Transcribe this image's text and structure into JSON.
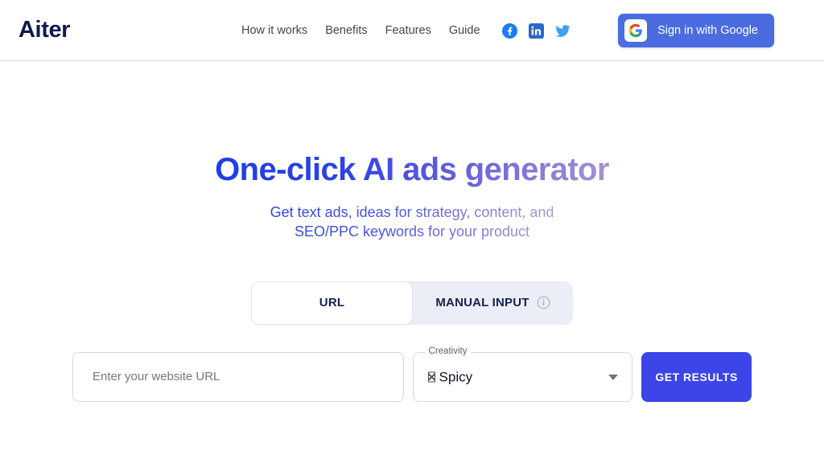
{
  "header": {
    "logo": "Aiter",
    "nav_items": [
      {
        "label": "How it works",
        "name": "nav-how-it-works"
      },
      {
        "label": "Benefits",
        "name": "nav-benefits"
      },
      {
        "label": "Features",
        "name": "nav-features"
      },
      {
        "label": "Guide",
        "name": "nav-guide"
      }
    ],
    "socials": [
      {
        "icon": "facebook-icon",
        "color": "#1d7bf2"
      },
      {
        "icon": "linkedin-icon",
        "color": "#2a68c8"
      },
      {
        "icon": "twitter-icon",
        "color": "#3ba1f0"
      }
    ],
    "google_button": {
      "label": "Sign in with Google",
      "icon": "google-g-icon",
      "background": "#4a6ce0"
    }
  },
  "hero": {
    "headline": "One-click AI ads generator",
    "headline_gradient_from": "#1f3ee8",
    "headline_gradient_to": "#a394d2",
    "subhead_line1": "Get text ads, ideas for strategy, content, and",
    "subhead_line2": "SEO/PPC keywords for your product"
  },
  "tabs": {
    "items": [
      {
        "label": "URL",
        "active": true,
        "name": "tab-url"
      },
      {
        "label": "MANUAL INPUT",
        "active": false,
        "name": "tab-manual-input",
        "info_icon": "info-circle-icon"
      }
    ],
    "track_background": "#eceef7"
  },
  "form": {
    "url_input": {
      "placeholder": "Enter your website URL",
      "value": ""
    },
    "creativity": {
      "legend": "Creativity",
      "value": "Spicy",
      "value_glyph": "missing-glyph-box",
      "caret_icon": "caret-down-icon"
    },
    "submit": {
      "label": "GET RESULTS",
      "background": "#3b45e8"
    }
  }
}
